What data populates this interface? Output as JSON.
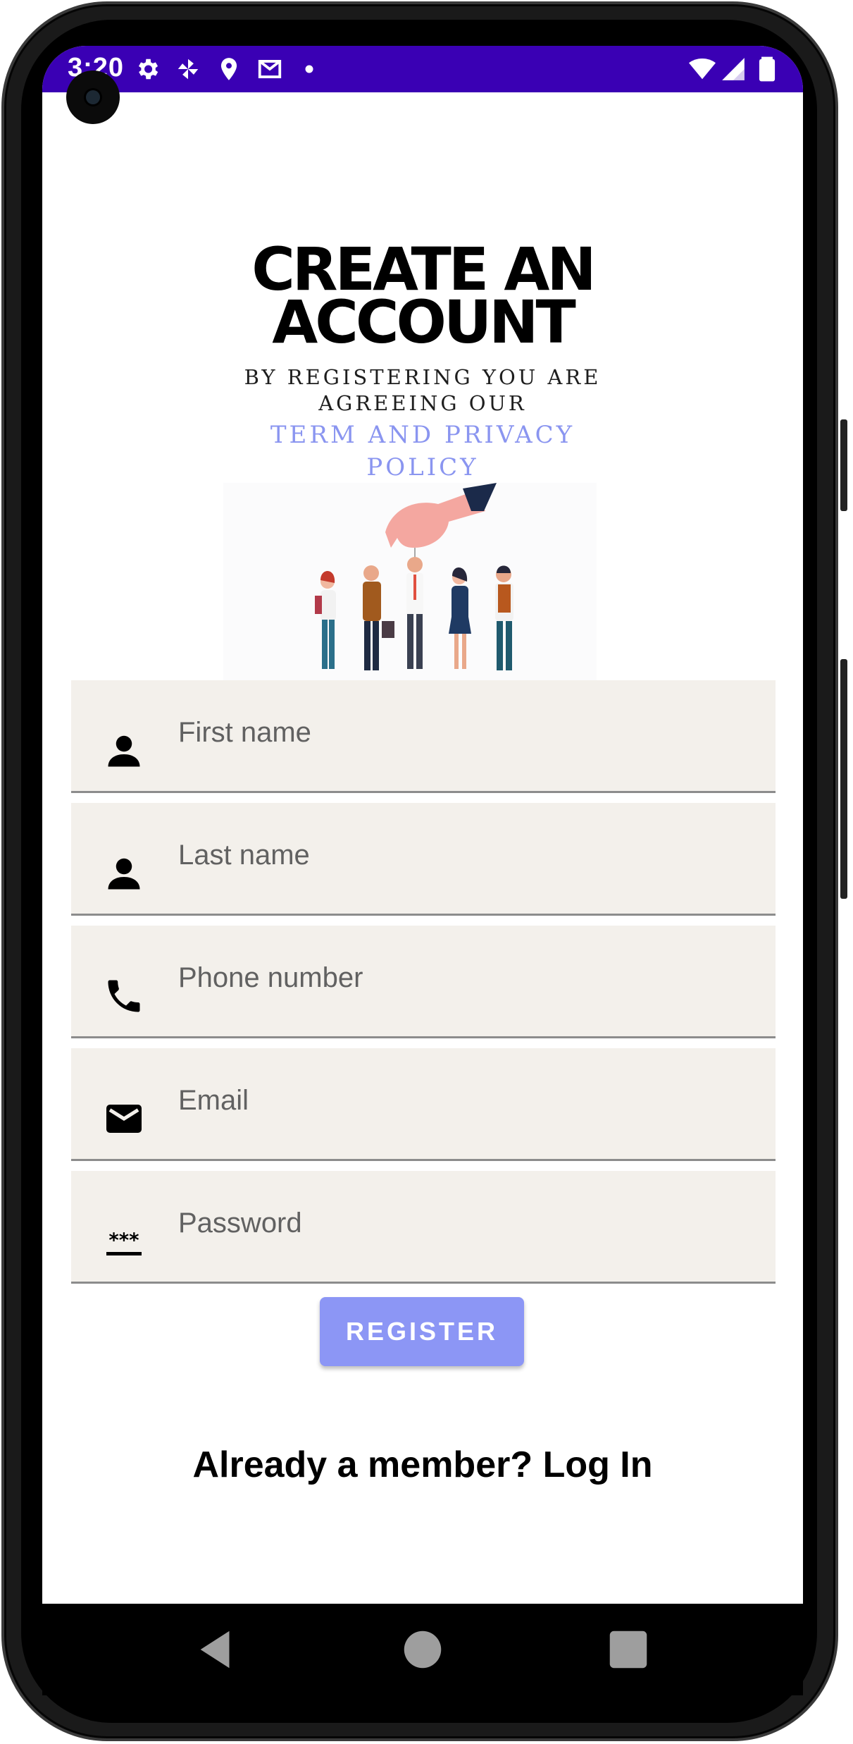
{
  "status_bar": {
    "time": "3:20",
    "icons": [
      "settings-icon",
      "pinwheel-icon",
      "location-icon",
      "gmail-icon",
      "dot-icon",
      "wifi-icon",
      "signal-icon",
      "battery-icon"
    ],
    "color": "#3a00b4"
  },
  "header": {
    "title_line1": "CREATE AN",
    "title_line2": "ACCOUNT",
    "subtitle_line1": "BY REGISTERING YOU ARE",
    "subtitle_line2": "AGREEING OUR",
    "policy_line1": "TERM AND PRIVACY",
    "policy_line2": "POLICY",
    "policy_color": "#8a95f0"
  },
  "form": {
    "fields": [
      {
        "placeholder": "First name",
        "icon": "person-icon"
      },
      {
        "placeholder": "Last name",
        "icon": "person-icon"
      },
      {
        "placeholder": "Phone number",
        "icon": "phone-icon"
      },
      {
        "placeholder": "Email",
        "icon": "email-icon"
      },
      {
        "placeholder": "Password",
        "icon": "password-icon"
      }
    ],
    "register_label": "REGISTER",
    "register_color": "#8c96f5"
  },
  "footer": {
    "login_text": "Already a member? Log In"
  },
  "nav": {
    "icons": [
      "back-icon",
      "home-icon",
      "recents-icon"
    ]
  }
}
